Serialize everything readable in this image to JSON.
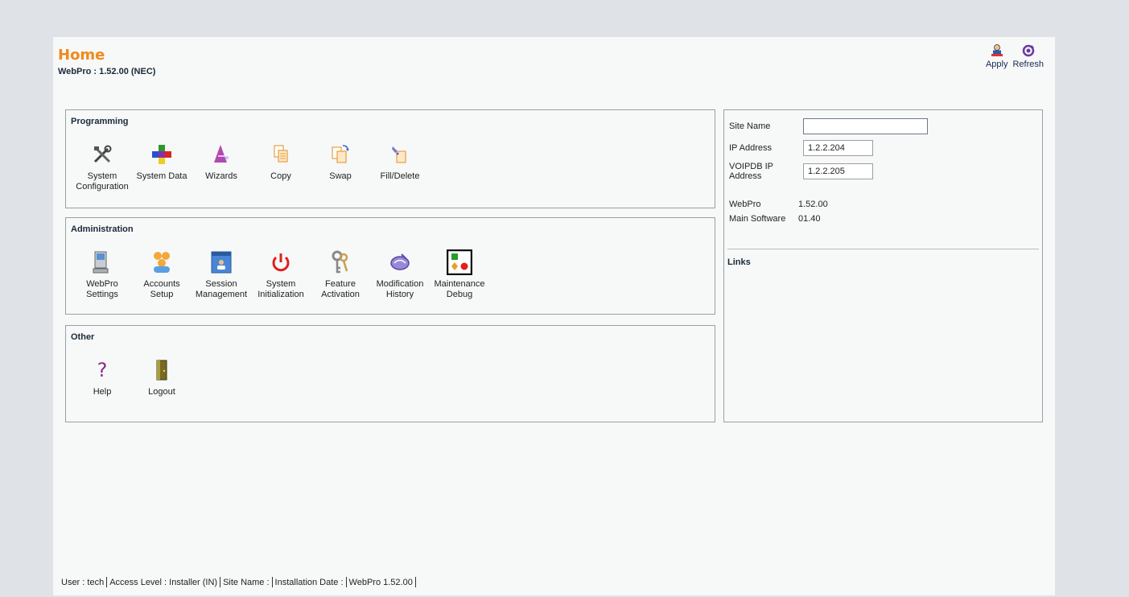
{
  "header": {
    "title": "Home",
    "subtitle": "WebPro : 1.52.00 (NEC)"
  },
  "toolbar": {
    "apply_label": "Apply",
    "refresh_label": "Refresh"
  },
  "programming": {
    "title": "Programming",
    "items": [
      {
        "label": "System\nConfiguration",
        "icon": "tools-icon"
      },
      {
        "label": "System Data",
        "icon": "cubes-icon"
      },
      {
        "label": "Wizards",
        "icon": "wizard-hat-icon"
      },
      {
        "label": "Copy",
        "icon": "copy-icon"
      },
      {
        "label": "Swap",
        "icon": "swap-icon"
      },
      {
        "label": "Fill/Delete",
        "icon": "fill-delete-icon"
      }
    ]
  },
  "administration": {
    "title": "Administration",
    "items": [
      {
        "label": "WebPro\nSettings",
        "icon": "computer-icon"
      },
      {
        "label": "Accounts\nSetup",
        "icon": "users-icon"
      },
      {
        "label": "Session\nManagement",
        "icon": "session-window-icon"
      },
      {
        "label": "System\nInitialization",
        "icon": "power-icon"
      },
      {
        "label": "Feature\nActivation",
        "icon": "keys-icon"
      },
      {
        "label": "Modification\nHistory",
        "icon": "history-icon"
      },
      {
        "label": "Maintenance\nDebug",
        "icon": "maintenance-icon"
      }
    ]
  },
  "other": {
    "title": "Other",
    "items": [
      {
        "label": "Help",
        "icon": "help-icon"
      },
      {
        "label": "Logout",
        "icon": "logout-door-icon"
      }
    ]
  },
  "site_info": {
    "site_name_label": "Site Name",
    "site_name_value": "",
    "ip_label": "IP Address",
    "ip_value": "1.2.2.204",
    "voipdb_label": "VOIPDB IP Address",
    "voipdb_value": "1.2.2.205",
    "webpro_label": "WebPro",
    "webpro_value": "1.52.00",
    "main_sw_label": "Main Software",
    "main_sw_value": "01.40",
    "links_title": "Links"
  },
  "footer": {
    "user": "User : tech",
    "access": "Access Level : Installer (IN)",
    "site": "Site Name :",
    "install": "Installation Date :",
    "version": "WebPro 1.52.00"
  },
  "colors": {
    "title_orange": "#f08a1c",
    "page_bg": "#f7f8f8",
    "outer_bg": "#dfe3e8",
    "border": "#9aa0a6"
  }
}
